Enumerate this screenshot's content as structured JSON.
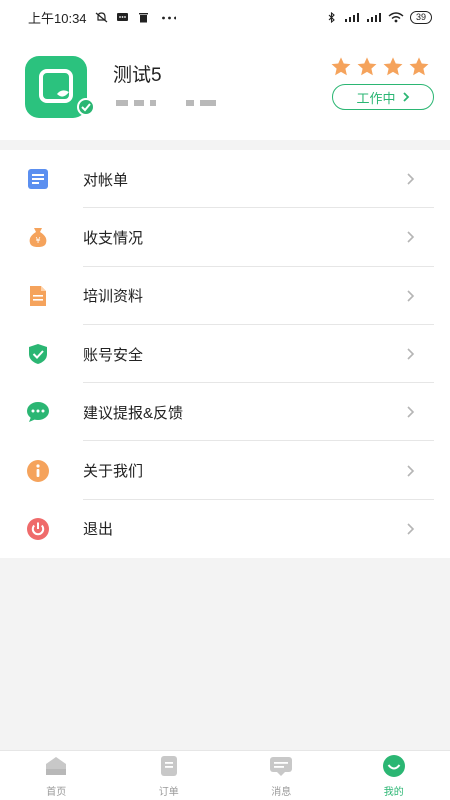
{
  "status_bar": {
    "time": "上午10:34",
    "battery": "39"
  },
  "profile": {
    "name": "测试5",
    "stars": 4,
    "status_label": "工作中",
    "accent": "#2bb673",
    "star_color": "#f5a35c"
  },
  "menu": {
    "items": [
      {
        "key": "statement",
        "label": "对帐单",
        "icon": "document-icon",
        "color": "#5b8ff0"
      },
      {
        "key": "income",
        "label": "收支情况",
        "icon": "money-bag-icon",
        "color": "#f5a35c"
      },
      {
        "key": "training",
        "label": "培训资料",
        "icon": "file-icon",
        "color": "#f5a35c"
      },
      {
        "key": "security",
        "label": "账号安全",
        "icon": "shield-icon",
        "color": "#2bb673"
      },
      {
        "key": "feedback",
        "label": "建议提报&反馈",
        "icon": "chat-icon",
        "color": "#2bb673"
      },
      {
        "key": "about",
        "label": "关于我们",
        "icon": "info-icon",
        "color": "#f5a35c"
      },
      {
        "key": "logout",
        "label": "退出",
        "icon": "power-icon",
        "color": "#ef6b6b"
      }
    ]
  },
  "tabbar": {
    "tabs": [
      {
        "key": "home",
        "label": "首页",
        "icon": "home-icon",
        "active": false
      },
      {
        "key": "orders",
        "label": "订单",
        "icon": "orders-icon",
        "active": false
      },
      {
        "key": "messages",
        "label": "消息",
        "icon": "message-icon",
        "active": false
      },
      {
        "key": "mine",
        "label": "我的",
        "icon": "smile-icon",
        "active": true
      }
    ]
  }
}
